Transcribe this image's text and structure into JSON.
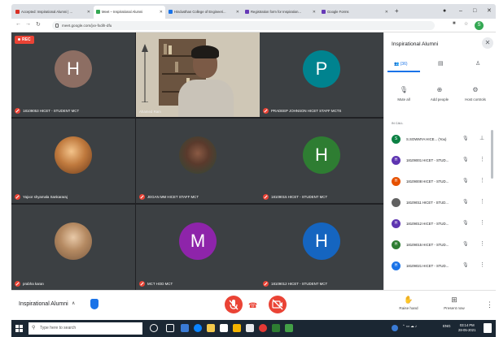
{
  "browser": {
    "tabs": [
      {
        "title": "Accepted: Inspirational Alumni | ...",
        "favicon_color": "#d93025"
      },
      {
        "title": "Meet – Inspirational Alumni",
        "favicon_color": "#34a853"
      },
      {
        "title": "Hindusthan College of Engineeri...",
        "favicon_color": "#1a73e8"
      },
      {
        "title": "Registration form for Inspiration...",
        "favicon_color": "#673ab7"
      },
      {
        "title": "Google Forms",
        "favicon_color": "#673ab7"
      }
    ],
    "new_tab": "+",
    "url": "meet.google.com/jxv-fxdih-dfu",
    "profile_initial": "S"
  },
  "meeting": {
    "rec_label": "REC",
    "tiles": [
      {
        "name": "18109053 HICET - STUDENT MCT",
        "kind": "initial",
        "initial": "H",
        "color": "#8d6e63",
        "muted": true
      },
      {
        "name": "Ahamed Ram",
        "kind": "video",
        "muted": false
      },
      {
        "name": "PRADEEP JOHNSON HICET STAFF MCTS",
        "kind": "initial",
        "initial": "P",
        "color": "#00838f",
        "muted": true
      },
      {
        "name": "Yajoor shyamala Sankararaj",
        "kind": "photo",
        "color": "#b57a4a",
        "muted": true
      },
      {
        "name": "JEGAN MM HICET STAFF MCT",
        "kind": "photo",
        "color": "#6d4c3d",
        "muted": true
      },
      {
        "name": "18109015 HICET - STUDENT MCT",
        "kind": "initial",
        "initial": "H",
        "color": "#2e7d32",
        "muted": true
      },
      {
        "name": "prabha karan",
        "kind": "photo",
        "color": "#c8a27a",
        "muted": true
      },
      {
        "name": "MCT HOD MCT",
        "kind": "initial",
        "initial": "M",
        "color": "#8e24aa",
        "muted": true
      },
      {
        "name": "18109012 HICET - STUDENT MCT",
        "kind": "initial",
        "initial": "H",
        "color": "#1565c0",
        "muted": true
      }
    ]
  },
  "bottom_bar": {
    "meeting_name": "Inspirational Alumni",
    "raise_hand": "Raise hand",
    "present_now": "Present now"
  },
  "panel": {
    "title": "Inspirational Alumni",
    "people_count": "(36)",
    "actions": [
      "Mute all",
      "Add people",
      "Host controls"
    ],
    "section_label": "IN CALL",
    "participants": [
      {
        "name": "S.SOWMYA HICE...",
        "suffix": "(You)",
        "initial": "S",
        "color": "#0b8043"
      },
      {
        "name": "18109001 HICET - STUD...",
        "initial": "H",
        "color": "#5e35b1"
      },
      {
        "name": "18109008 HICET - STUD...",
        "initial": "H",
        "color": "#e65100"
      },
      {
        "name": "18109011 HICET - STUD...",
        "initial": "",
        "color": "#616161"
      },
      {
        "name": "18109012 HICET - STUD...",
        "initial": "H",
        "color": "#5e35b1"
      },
      {
        "name": "18109015 HICET - STUD...",
        "initial": "H",
        "color": "#2e7d32"
      },
      {
        "name": "18109021 HICET - STUD...",
        "initial": "H",
        "color": "#1a73e8"
      }
    ]
  },
  "taskbar": {
    "search_placeholder": "Type here to search",
    "tray_text": "ENG",
    "time": "03:14 PM",
    "date": "28-05-2021"
  }
}
